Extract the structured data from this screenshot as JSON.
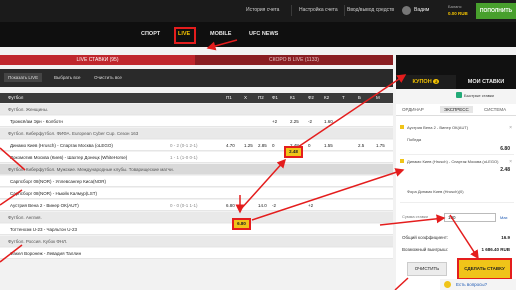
{
  "topbar": {
    "history": "История счета",
    "settings": "Настройка счета",
    "deposit_withdraw": "Ввод/вывод средств",
    "username": "Вадим",
    "balance_label": "Баланс",
    "balance_value": "0.00 RUB",
    "deposit_button": "ПОПОЛНИТЬ"
  },
  "nav": {
    "sport": "СПОРТ",
    "live": "LIVE",
    "mobile": "MOBILE",
    "ufc": "UFC NEWS"
  },
  "tabs": {
    "live_bets": "LIVE СТАВКИ (95)",
    "coming_soon": "СКОРО В LIVE (1133)"
  },
  "toolbar": {
    "show_live": "Показать LIVE",
    "select_all": "Выбрать все",
    "clear_all": "Очистить все"
  },
  "table": {
    "headers": [
      "Футбол",
      "П1",
      "Х",
      "П2",
      "Ф1",
      "К1",
      "Ф2",
      "К2",
      "Т",
      "Б",
      "М"
    ],
    "rows": [
      {
        "type": "league",
        "name": "Футбол. Женщины."
      },
      {
        "type": "match",
        "name": "Тромсё/ам Эрн - Колботн",
        "score": "",
        "p1": "",
        "x": "",
        "p2": "",
        "f1": "+2",
        "k1": "2.25",
        "f2": "-2",
        "k2": "1.60",
        "t": "",
        "b": "",
        "m": ""
      },
      {
        "type": "league",
        "name": "Футбол. Киберфутбол. ФИФА. European Cyber Cup. Сезон 163"
      },
      {
        "type": "match",
        "name": "Динамо Киев (Hrusch) - Спартак Москва (oLEGO)",
        "score": "0 - 2 (0-1 2-1)",
        "p1": "4.70",
        "x": "1.25",
        "p2": "2.85",
        "f1": "0",
        "k1": "2.48",
        "f2": "0",
        "k2": "1.55",
        "t": "",
        "b": "2.5",
        "m": "1.75"
      },
      {
        "type": "match",
        "name": "Локомотив Москва (Киев) - Шахтер Донецк (WhiteHorse)",
        "score": "1 - 1 (1-0 0-1)",
        "p1": "",
        "x": "",
        "p2": "",
        "f1": "",
        "k1": "",
        "f2": "",
        "k2": "",
        "t": "",
        "b": "",
        "m": ""
      },
      {
        "type": "grp",
        "name": "Футбол. Киберфутбол. Мужские. Международные клубы. Товарищеские матчи."
      },
      {
        "type": "match",
        "name": "Сарпсборг 08(NOR) - Уллевсангер Киса(NOR)",
        "score": "",
        "p1": "",
        "x": "",
        "p2": "",
        "f1": "",
        "k1": "",
        "f2": "",
        "k2": "",
        "t": "",
        "b": "",
        "m": ""
      },
      {
        "type": "match",
        "name": "Сарпсборг 08(NOR) - Ньюйк Калмур(LST)",
        "score": "",
        "p1": "",
        "x": "",
        "p2": "",
        "f1": "",
        "k1": "",
        "f2": "",
        "k2": "",
        "t": "",
        "b": "",
        "m": ""
      },
      {
        "type": "match",
        "name": "Аустрия Вена 2 - Винер ОК(AUT)",
        "score": "0 - 0 (0-1 1-1)",
        "p1": "6.80",
        "x": "",
        "p2": "14.0",
        "f1": "-2",
        "k1": "",
        "f2": "+2",
        "k2": "",
        "t": "",
        "b": "",
        "m": ""
      },
      {
        "type": "league",
        "name": "Футбол. Англия."
      },
      {
        "type": "match",
        "name": "Тоттенхэм U-23 - Чарльтон U-23",
        "score": "",
        "p1": "",
        "x": "",
        "p2": "",
        "f1": "",
        "k1": "",
        "f2": "",
        "k2": "",
        "t": "",
        "b": "",
        "m": ""
      },
      {
        "type": "league",
        "name": "Футбол. Россия. Кубок ФНЛ."
      },
      {
        "type": "match",
        "name": "Факел Воронеж - Левадия Таллин",
        "score": "",
        "p1": "",
        "x": "",
        "p2": "",
        "f1": "",
        "k1": "",
        "f2": "",
        "k2": "",
        "t": "",
        "b": "",
        "m": ""
      }
    ],
    "highlight_k1": "2.48",
    "highlight_p1": "6.80"
  },
  "coupon": {
    "tab_coupon": "КУПОН",
    "tab_coupon_count": "2",
    "tab_my_bets": "МОИ СТАВКИ",
    "quick_bets": "Быстрые ставки",
    "sub_ordinary": "ОРДИНАР",
    "sub_express": "ЭКСПРЕСС",
    "sub_system": "СИСТЕМА",
    "bet1_title": "Аустрия Вена 2 - Винер ОК(AUT)",
    "bet1_detail": "Победа",
    "bet1_value": "6.80",
    "bet2_title": "Динамо Киев (Hrusch) - Спартак Москва (oLEGO)",
    "bet2_detail": "Фора Динамо Киев (Hrusch)(0)",
    "bet2_value": "2.48",
    "stake_label": "Сумма ставки",
    "stake_value": "100",
    "stake_max": "Max",
    "total_coef_label": "Общий коэффициент:",
    "total_coef_value": "16.9",
    "possible_win_label": "Возможный выигрыш:",
    "possible_win_value": "1 686.40 RUB",
    "clear_button": "ОЧИСТИТЬ",
    "make_bet_button": "СДЕЛАТЬ СТАВКУ",
    "question": "Есть вопросы?"
  },
  "colors": {
    "accent_red": "#e41d1d",
    "brand_yellow": "#f0c419",
    "deposit_green": "#48a02d",
    "tab_red": "#c0272d"
  }
}
